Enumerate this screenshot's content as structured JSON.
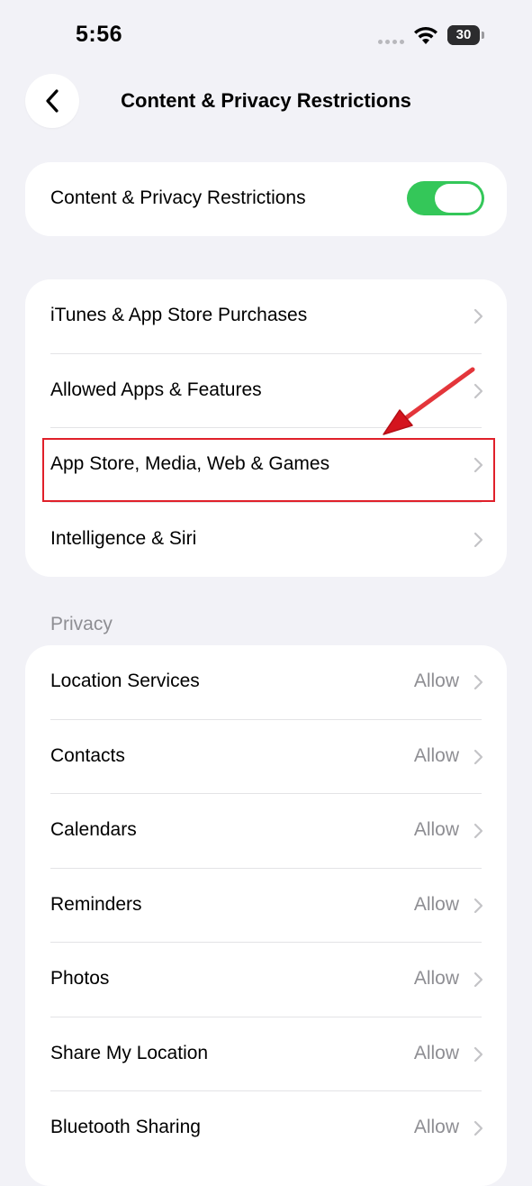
{
  "status_bar": {
    "time": "5:56",
    "battery": "30"
  },
  "nav": {
    "title": "Content & Privacy Restrictions"
  },
  "master_toggle": {
    "label": "Content & Privacy Restrictions",
    "state": "on",
    "color": "#34c759"
  },
  "restrictions": {
    "items": [
      {
        "label": "iTunes & App Store Purchases"
      },
      {
        "label": "Allowed Apps & Features"
      },
      {
        "label": "App Store, Media, Web & Games"
      },
      {
        "label": "Intelligence & Siri"
      }
    ]
  },
  "privacy": {
    "header": "Privacy",
    "items": [
      {
        "label": "Location Services",
        "value": "Allow"
      },
      {
        "label": "Contacts",
        "value": "Allow"
      },
      {
        "label": "Calendars",
        "value": "Allow"
      },
      {
        "label": "Reminders",
        "value": "Allow"
      },
      {
        "label": "Photos",
        "value": "Allow"
      },
      {
        "label": "Share My Location",
        "value": "Allow"
      },
      {
        "label": "Bluetooth Sharing",
        "value": "Allow"
      }
    ]
  },
  "annotation": {
    "color": "#e0202a",
    "icon": "red-arrow-icon"
  }
}
